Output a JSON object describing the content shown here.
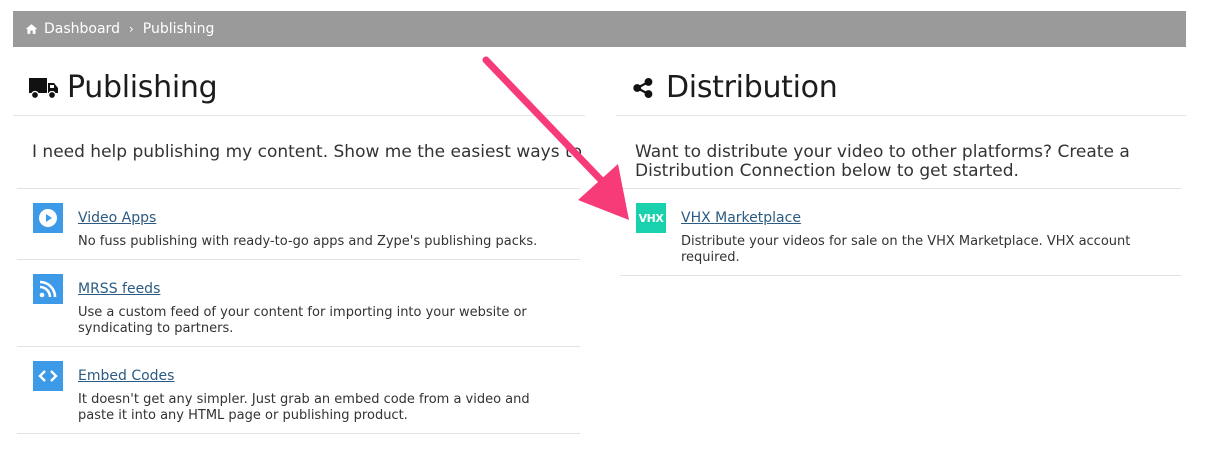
{
  "breadcrumb": {
    "home": "Dashboard",
    "current": "Publishing"
  },
  "publishing": {
    "title": "Publishing",
    "intro": "I need help publishing my content. Show me the easiest ways to get started.",
    "items": [
      {
        "title": "Video Apps",
        "desc": "No fuss publishing with ready-to-go apps and Zype's publishing packs.",
        "icon": "play-icon"
      },
      {
        "title": "MRSS feeds",
        "desc": "Use a custom feed of your content for importing into your website or syndicating to partners.",
        "icon": "rss-icon"
      },
      {
        "title": "Embed Codes",
        "desc": "It doesn't get any simpler. Just grab an embed code from a video and paste it into any HTML page or publishing product.",
        "icon": "code-icon"
      }
    ]
  },
  "distribution": {
    "title": "Distribution",
    "intro": "Want to distribute your video to other platforms? Create a Distribution Connection below to get started.",
    "items": [
      {
        "title": "VHX Marketplace",
        "desc": "Distribute your videos for sale on the VHX Marketplace. VHX account required.",
        "icon_text": "VHX"
      }
    ]
  },
  "colors": {
    "accent": "#3d9ae8",
    "vhx": "#19d1ad",
    "arrow": "#f73a78",
    "topbar": "#9a9a9a"
  }
}
